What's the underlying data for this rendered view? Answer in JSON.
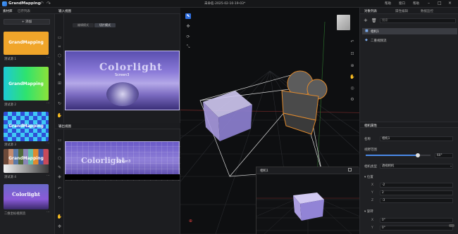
{
  "app": {
    "title": "GrandMapping",
    "doc_title": "未命名-2025-02-10-19-03*"
  },
  "menu": [
    "帮助",
    "窗口",
    "帮助"
  ],
  "left_panel": {
    "tabs": [
      "素材库",
      "已存列表"
    ],
    "add_label": "+ 添加",
    "cards": [
      {
        "label": "测试源 1",
        "text": "GrandMapping"
      },
      {
        "label": "测试源 2",
        "text": "GrandMapping"
      },
      {
        "label": "测试源 3",
        "text": "GrandMapping"
      },
      {
        "label": "测试源 4",
        "text": "GrandMapping"
      },
      {
        "label": "二维坐标视频流",
        "text": "Colorlight"
      }
    ]
  },
  "input_view": {
    "title": "输入视图",
    "modes": [
      "编辑模式",
      "切片模式"
    ],
    "image_text": "Colorlight",
    "screen_label": "Screen3"
  },
  "output_view": {
    "title": "输出视图",
    "image_text": "Colorlight",
    "screen_label": "Screen3"
  },
  "viewport": {
    "camera_label": "相机1"
  },
  "object_list": {
    "tabs": [
      "对象列表",
      "属性编辑",
      "数据监控"
    ],
    "search_placeholder": "搜索",
    "items": [
      "相机1",
      "二重视频流"
    ]
  },
  "camera_props": {
    "title": "相机属性",
    "name_label": "名称",
    "name_value": "相机1",
    "fov_label": "视野范围",
    "fov_value": "60°",
    "fov_fraction": 0.8,
    "type_label": "相机类型",
    "type_value": "透视相机",
    "position_label": "位置",
    "position": [
      {
        "axis": "X",
        "value": "-2"
      },
      {
        "axis": "Y",
        "value": "2"
      },
      {
        "axis": "Z",
        "value": "-3"
      }
    ],
    "rotation_label": "旋转",
    "rotation": [
      {
        "axis": "X",
        "value": "0°"
      },
      {
        "axis": "Y",
        "value": "0°"
      }
    ]
  }
}
